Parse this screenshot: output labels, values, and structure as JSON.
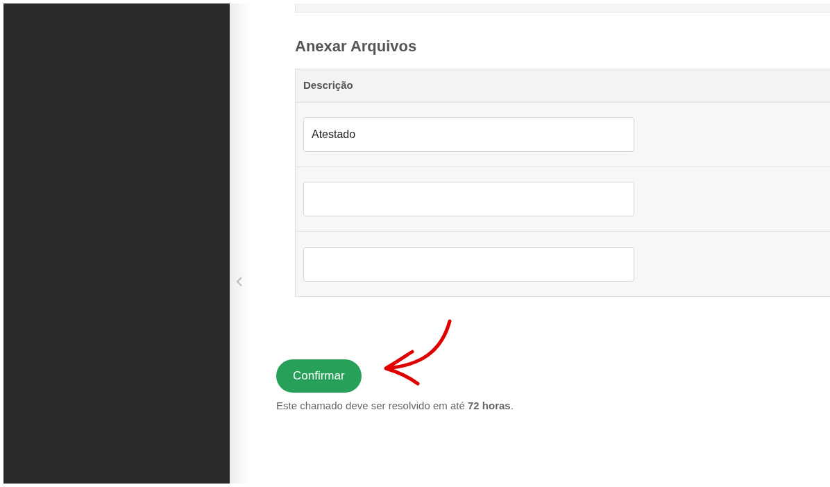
{
  "section": {
    "title": "Anexar Arquivos"
  },
  "table": {
    "columns": [
      "Descrição"
    ],
    "rows": [
      {
        "kind": "filled",
        "value": "Atestado"
      },
      {
        "kind": "blank"
      },
      {
        "kind": "blank"
      }
    ]
  },
  "confirm_button": "Confirmar",
  "note": "Este chamado deve ser resolvido em até **72 horas**."
}
